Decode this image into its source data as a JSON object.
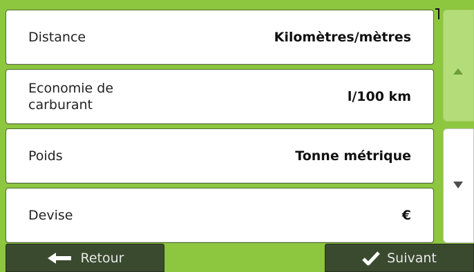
{
  "settings": {
    "rows": [
      {
        "label": "Distance",
        "value": "Kilomètres/mètres"
      },
      {
        "label": "Economie de carburant",
        "value": "l/100 km"
      },
      {
        "label": "Poids",
        "value": "Tonne métrique"
      },
      {
        "label": "Devise",
        "value": "€"
      }
    ]
  },
  "footer": {
    "back_label": "Retour",
    "next_label": "Suivant"
  },
  "icons": {
    "back": "arrow-left-icon",
    "next": "checkmark-icon",
    "scroll_up": "triangle-up-icon",
    "scroll_down": "triangle-down-icon"
  },
  "colors": {
    "background": "#8dc63f",
    "button_dark": "#3a4a2e",
    "scroll_up_bg": "#b4dd7a"
  }
}
